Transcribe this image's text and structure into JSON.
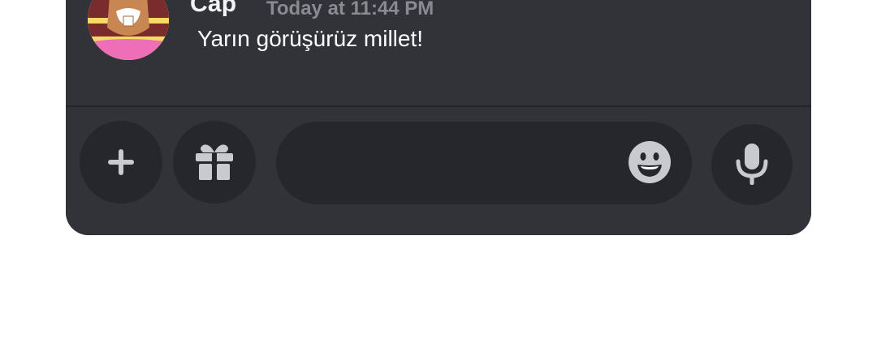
{
  "message": {
    "username": "Cap",
    "timestamp": "Today at 11:44 PM",
    "text": "Yarın görüşürüz millet!",
    "avatar_icon": "beaver-avatar-icon"
  },
  "composer": {
    "input_value": "",
    "input_placeholder": "",
    "buttons": {
      "add": "plus-icon",
      "gift": "gift-icon",
      "emoji": "emoji-icon",
      "voice": "microphone-icon"
    }
  },
  "colors": {
    "panel": "#323239",
    "button_bg": "#26262d",
    "username": "#f2f3f5",
    "timestamp": "#8a8b92",
    "icon": "#c9cad0"
  }
}
